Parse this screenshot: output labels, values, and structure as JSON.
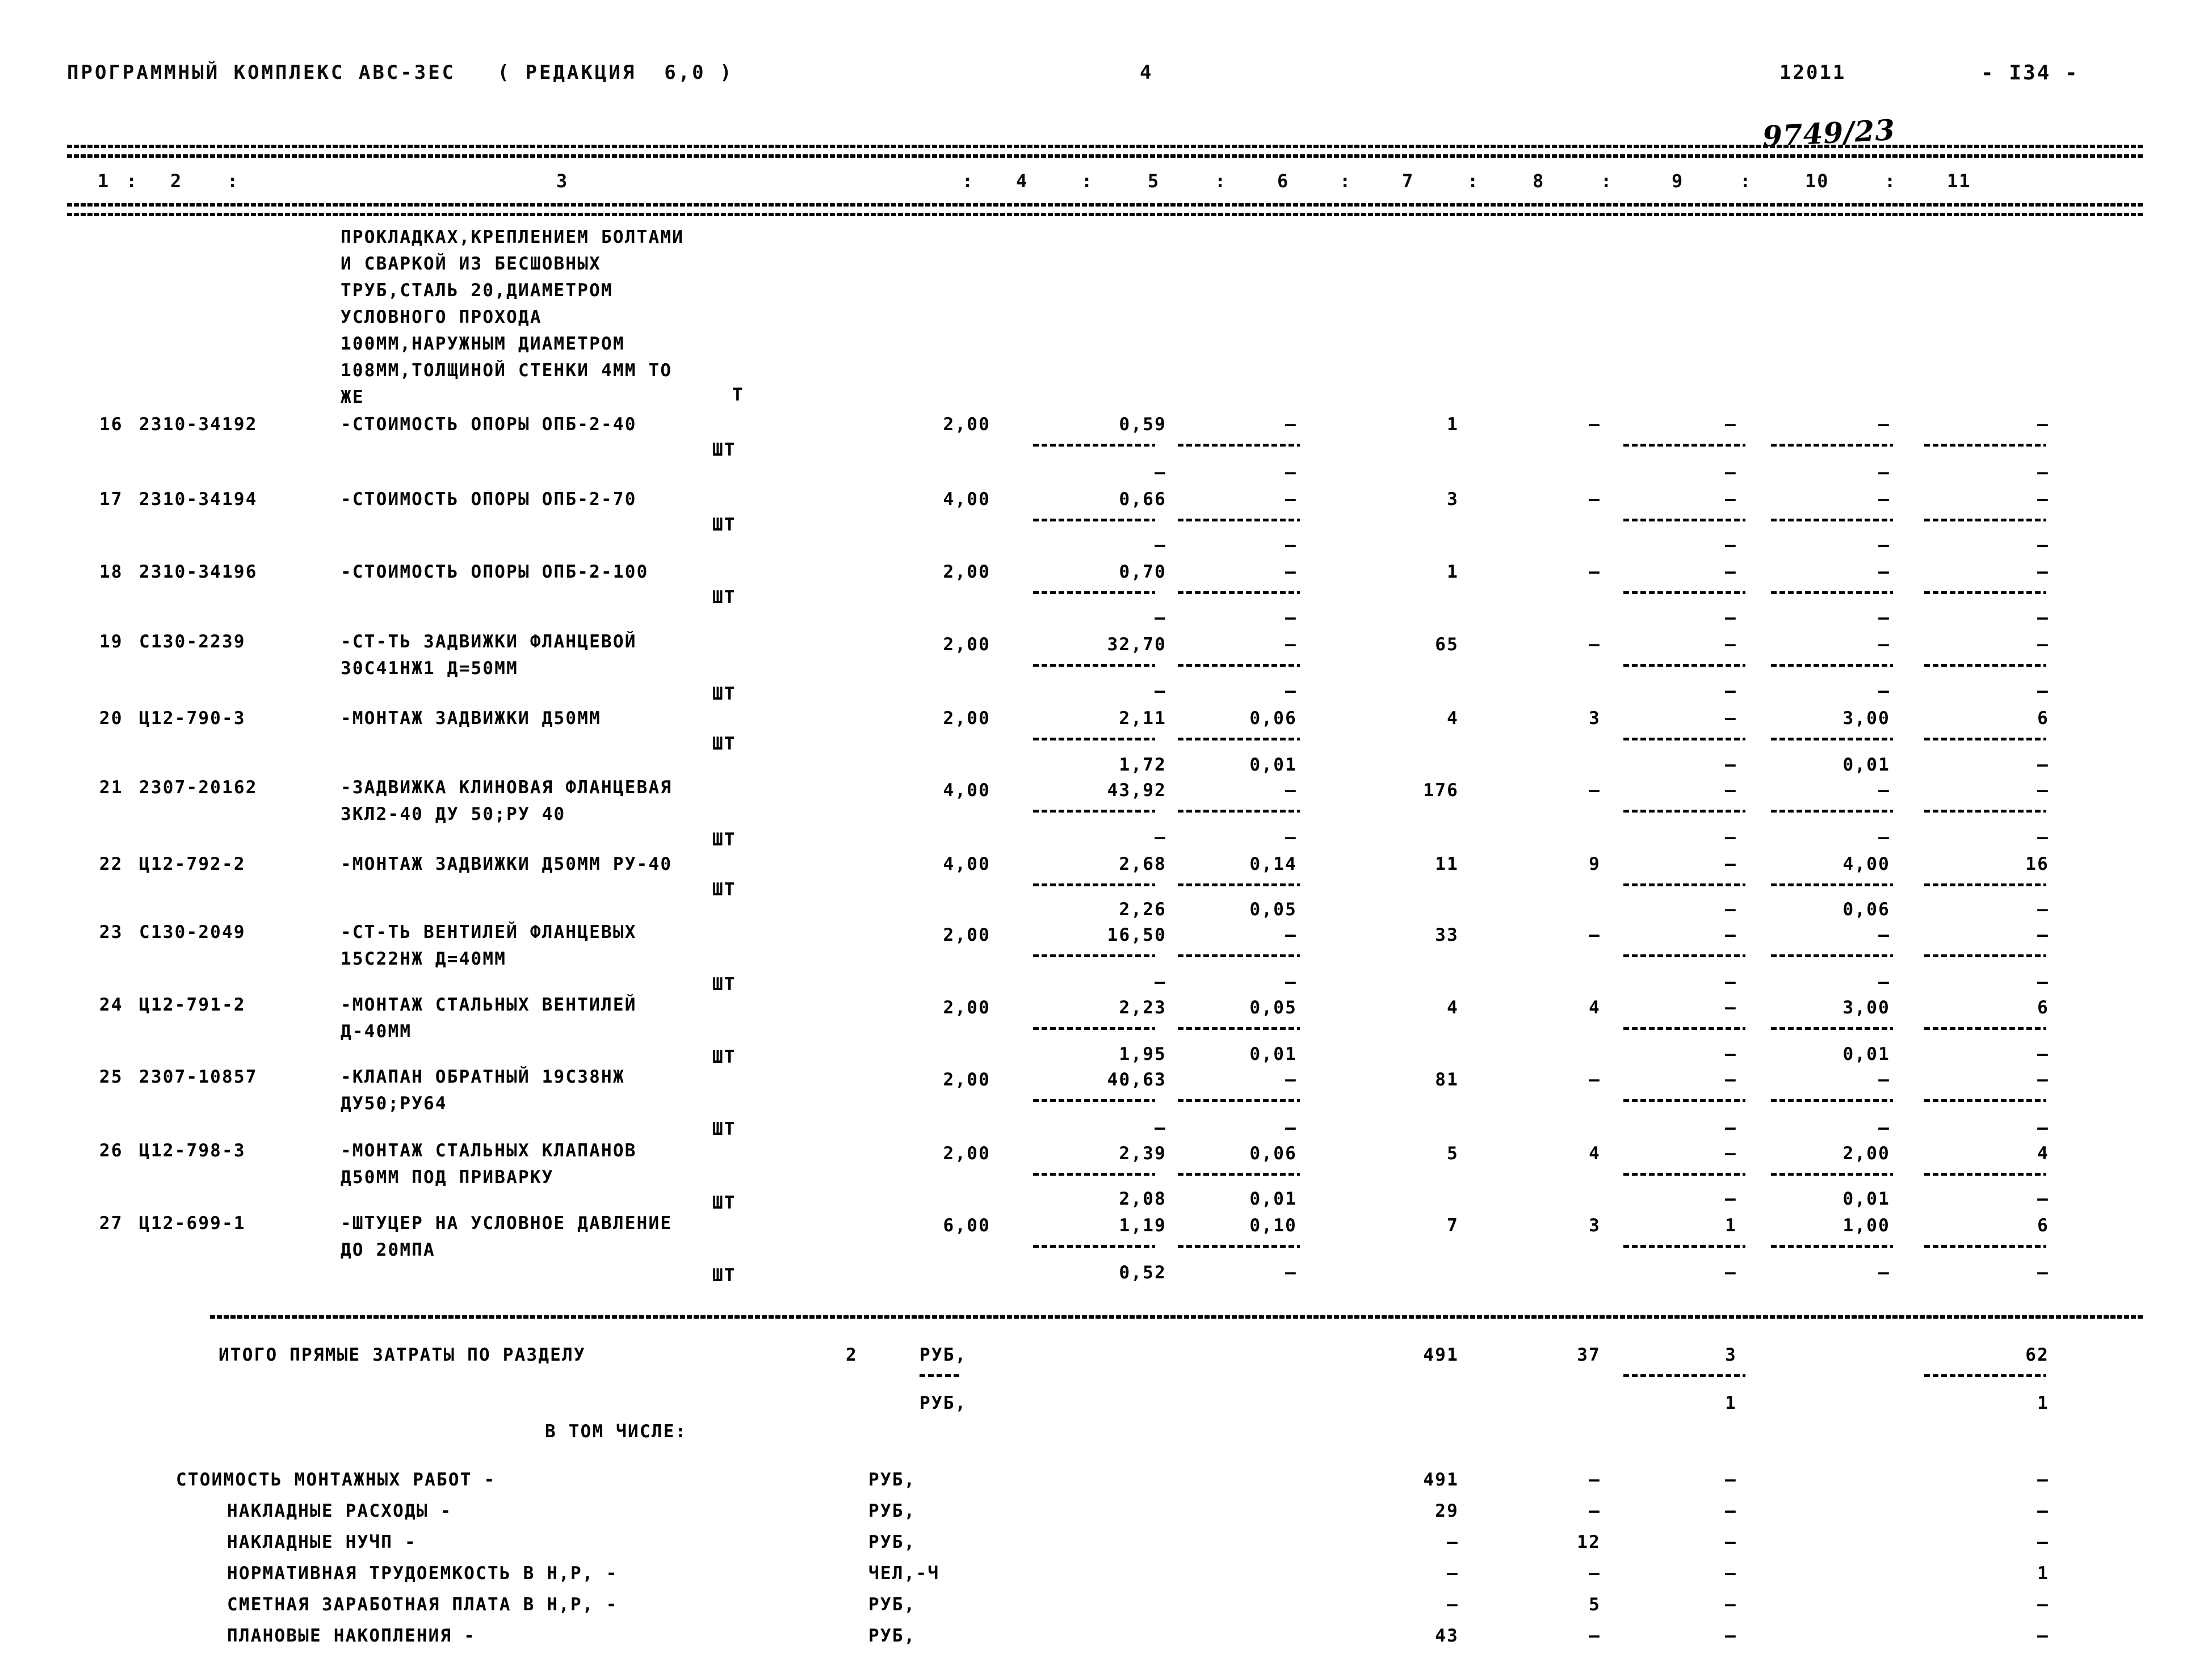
{
  "header": {
    "program_title": "ПРОГРАММНЫЙ КОМПЛЕКС АВС-3ЕС   ( РЕДАКЦИЯ  6,0 )",
    "sheet_no": "4",
    "doc_code": "12011",
    "page_label": "- I34 -",
    "handwritten_note": "9749/23"
  },
  "column_headers": [
    "1",
    "2",
    "3",
    "4",
    "5",
    "6",
    "7",
    "8",
    "9",
    "10",
    "11"
  ],
  "column_separator": ":",
  "continued_description": [
    "ПРОКЛАДКАХ,КРЕПЛЕНИЕМ БОЛТАМИ",
    "И СВАРКОЙ ИЗ БЕСШОВНЫХ",
    "ТРУБ,СТАЛЬ 20,ДИАМЕТРОМ",
    "УСЛОВНОГО ПРОХОДА",
    "100ММ,НАРУЖНЫМ ДИАМЕТРОМ",
    "108ММ,ТОЛЩИНОЙ СТЕНКИ 4ММ ТО",
    "ЖЕ"
  ],
  "rows": [
    {
      "no": "16",
      "code": "2310-34192",
      "desc": [
        "-СТОИМОСТЬ ОПОРЫ ОПБ-2-40"
      ],
      "unit_top": "Т",
      "unit_bottom": "ШТ",
      "c4": "2,00",
      "c5": "0,59",
      "c6": "–",
      "c7": "1",
      "c8": "–",
      "c9": "–",
      "c10": "–",
      "c11": "–",
      "sub5": "",
      "sub6": "",
      "sub9": "–",
      "sub10": "–",
      "sub11": "–"
    },
    {
      "no": "17",
      "code": "2310-34194",
      "desc": [
        "-СТОИМОСТЬ ОПОРЫ ОПБ-2-70"
      ],
      "unit_top": "",
      "unit_bottom": "ШТ",
      "c4": "4,00",
      "c5": "0,66",
      "c6": "–",
      "c7": "3",
      "c8": "–",
      "c9": "–",
      "c10": "–",
      "c11": "–",
      "sub5": "–",
      "sub6": "–",
      "sub9": "–",
      "sub10": "–",
      "sub11": "–"
    },
    {
      "no": "18",
      "code": "2310-34196",
      "desc": [
        "-СТОИМОСТЬ ОПОРЫ ОПБ-2-100"
      ],
      "unit_top": "",
      "unit_bottom": "ШТ",
      "c4": "2,00",
      "c5": "0,70",
      "c6": "–",
      "c7": "1",
      "c8": "–",
      "c9": "–",
      "c10": "–",
      "c11": "–",
      "sub5": "–",
      "sub6": "–",
      "sub9": "–",
      "sub10": "–",
      "sub11": "–"
    },
    {
      "no": "19",
      "code": "С130-2239",
      "desc": [
        "-СТ-ТЬ ЗАДВИЖКИ ФЛАНЦЕВОЙ",
        "30С41НЖ1 Д=50ММ"
      ],
      "unit_top": "",
      "unit_bottom": "ШТ",
      "c4": "2,00",
      "c5": "32,70",
      "c6": "–",
      "c7": "65",
      "c8": "–",
      "c9": "–",
      "c10": "–",
      "c11": "–",
      "sub5": "–",
      "sub6": "–",
      "sub9": "–",
      "sub10": "–",
      "sub11": "–"
    },
    {
      "no": "20",
      "code": "Ц12-790-3",
      "desc": [
        "-МОНТАЖ ЗАДВИЖКИ Д50ММ"
      ],
      "unit_top": "",
      "unit_bottom": "ШТ",
      "c4": "2,00",
      "c5": "2,11",
      "c6": "0,06",
      "c7": "4",
      "c8": "3",
      "c9": "–",
      "c10": "3,00",
      "c11": "6",
      "sub5": "–",
      "sub6": "–",
      "sub9": "–",
      "sub10": "–",
      "sub11": "–"
    },
    {
      "no": "21",
      "code": "2307-20162",
      "desc": [
        "-ЗАДВИЖКА КЛИНОВАЯ ФЛАНЦЕВАЯ",
        "ЗКЛ2-40 ДУ 50;РУ 40"
      ],
      "unit_top": "",
      "unit_bottom": "ШТ",
      "c4": "4,00",
      "c5": "43,92",
      "c6": "–",
      "c7": "176",
      "c8": "–",
      "c9": "–",
      "c10": "–",
      "c11": "–",
      "sub5": "1,72",
      "sub6": "0,01",
      "sub9": "–",
      "sub10": "0,01",
      "sub11": "–"
    },
    {
      "no": "22",
      "code": "Ц12-792-2",
      "desc": [
        "-МОНТАЖ ЗАДВИЖКИ Д50ММ РУ-40"
      ],
      "unit_top": "",
      "unit_bottom": "ШТ",
      "c4": "4,00",
      "c5": "2,68",
      "c6": "0,14",
      "c7": "11",
      "c8": "9",
      "c9": "–",
      "c10": "4,00",
      "c11": "16",
      "sub5": "–",
      "sub6": "–",
      "sub9": "–",
      "sub10": "–",
      "sub11": "–"
    },
    {
      "no": "23",
      "code": "С130-2049",
      "desc": [
        "-СТ-ТЬ ВЕНТИЛЕЙ ФЛАНЦЕВЫХ",
        "15С22НЖ Д=40ММ"
      ],
      "unit_top": "",
      "unit_bottom": "ШТ",
      "c4": "2,00",
      "c5": "16,50",
      "c6": "–",
      "c7": "33",
      "c8": "–",
      "c9": "–",
      "c10": "–",
      "c11": "–",
      "sub5": "2,26",
      "sub6": "0,05",
      "sub9": "–",
      "sub10": "0,06",
      "sub11": "–"
    },
    {
      "no": "24",
      "code": "Ц12-791-2",
      "desc": [
        "-МОНТАЖ СТАЛЬНЫХ ВЕНТИЛЕЙ",
        "Д-40ММ"
      ],
      "unit_top": "",
      "unit_bottom": "ШТ",
      "c4": "2,00",
      "c5": "2,23",
      "c6": "0,05",
      "c7": "4",
      "c8": "4",
      "c9": "–",
      "c10": "3,00",
      "c11": "6",
      "sub5": "–",
      "sub6": "–",
      "sub9": "–",
      "sub10": "–",
      "sub11": "–"
    },
    {
      "no": "25",
      "code": "2307-10857",
      "desc": [
        "-КЛАПАН ОБРАТНЫЙ 19С38НЖ",
        "ДУ50;РУ64"
      ],
      "unit_top": "",
      "unit_bottom": "ШТ",
      "c4": "2,00",
      "c5": "40,63",
      "c6": "–",
      "c7": "81",
      "c8": "–",
      "c9": "–",
      "c10": "–",
      "c11": "–",
      "sub5": "1,95",
      "sub6": "0,01",
      "sub9": "–",
      "sub10": "0,01",
      "sub11": "–"
    },
    {
      "no": "26",
      "code": "Ц12-798-3",
      "desc": [
        "-МОНТАЖ СТАЛЬНЫХ КЛАПАНОВ",
        "Д50ММ ПОД ПРИВАРКУ"
      ],
      "unit_top": "",
      "unit_bottom": "ШТ",
      "c4": "2,00",
      "c5": "2,39",
      "c6": "0,06",
      "c7": "5",
      "c8": "4",
      "c9": "–",
      "c10": "2,00",
      "c11": "4",
      "sub5": "–",
      "sub6": "–",
      "sub9": "–",
      "sub10": "–",
      "sub11": "–"
    },
    {
      "no": "27",
      "code": "Ц12-699-1",
      "desc": [
        "-ШТУЦЕР НА УСЛОВНОЕ ДАВЛЕНИЕ",
        "ДО 20МПА"
      ],
      "unit_top": "",
      "unit_bottom": "ШТ",
      "c4": "6,00",
      "c5": "1,19",
      "c6": "0,10",
      "c7": "7",
      "c8": "3",
      "c9": "1",
      "c10": "1,00",
      "c11": "6",
      "sub5": "2,08",
      "sub6": "0,01",
      "sub9": "–",
      "sub10": "0,01",
      "sub11": "–"
    }
  ],
  "row27_tail": {
    "c5": "0,52",
    "c6": "–",
    "c9": "–",
    "c10": "–",
    "c11": "–"
  },
  "totals": {
    "label": "ИТОГО ПРЯМЫЕ ЗАТРАТЫ ПО РАЗДЕЛУ",
    "section_no": "2",
    "unit1": "РУБ,",
    "unit2": "РУБ,",
    "c7": "491",
    "c8": "37",
    "c9": "3",
    "c11": "62",
    "c9_second": "1",
    "c11_second": "1",
    "in_which": "В ТОМ ЧИСЛЕ:"
  },
  "breakdown": [
    {
      "label": "СТОИМОСТЬ МОНТАЖНЫХ РАБОТ -",
      "unit": "РУБ,",
      "c7": "491",
      "c8": "–",
      "c9": "–",
      "c11": "–"
    },
    {
      "label": "НАКЛАДНЫЕ РАСХОДЫ -",
      "unit": "РУБ,",
      "c7": "29",
      "c8": "–",
      "c9": "–",
      "c11": "–"
    },
    {
      "label": "НАКЛАДНЫЕ НУЧП -",
      "unit": "РУБ,",
      "c7": "–",
      "c8": "12",
      "c9": "–",
      "c11": "–"
    },
    {
      "label": "НОРМАТИВНАЯ ТРУДОЕМКОСТЬ В Н,Р, -",
      "unit": "ЧЕЛ,-Ч",
      "c7": "–",
      "c8": "–",
      "c9": "–",
      "c11": "1"
    },
    {
      "label": "СМЕТНАЯ ЗАРАБОТНАЯ ПЛАТА В Н,Р, -",
      "unit": "РУБ,",
      "c7": "–",
      "c8": "5",
      "c9": "–",
      "c11": "–"
    },
    {
      "label": "ПЛАНОВЫЕ НАКОПЛЕНИЯ -",
      "unit": "РУБ,",
      "c7": "43",
      "c8": "–",
      "c9": "–",
      "c11": "–"
    }
  ]
}
